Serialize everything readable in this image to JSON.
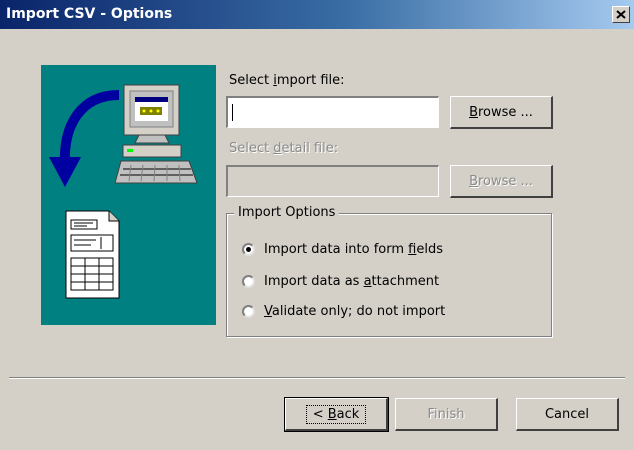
{
  "window": {
    "title": "Import CSV - Options"
  },
  "import_file": {
    "label_pre": "Select ",
    "label_key": "i",
    "label_post": "mport file:",
    "value": "",
    "browse_pre": "",
    "browse_key": "B",
    "browse_post": "rowse ..."
  },
  "detail_file": {
    "label_pre": "Select ",
    "label_key": "d",
    "label_post": "etail file:",
    "value": "",
    "browse_pre": "",
    "browse_key": "B",
    "browse_post": "rowse ..."
  },
  "options": {
    "legend": "Import Options",
    "items": [
      {
        "pre": "Import data into form ",
        "key": "f",
        "post": "ields",
        "selected": true
      },
      {
        "pre": "Import data as ",
        "key": "a",
        "post": "ttachment",
        "selected": false
      },
      {
        "pre": "",
        "key": "V",
        "post": "alidate only; do not import",
        "selected": false
      }
    ]
  },
  "buttons": {
    "back_pre": "< ",
    "back_key": "B",
    "back_post": "ack",
    "finish": "Finish",
    "cancel": "Cancel"
  },
  "colors": {
    "panel": "#008080",
    "face": "#d4d0c8",
    "title_start": "#0a246a",
    "title_end": "#a6caf0"
  }
}
